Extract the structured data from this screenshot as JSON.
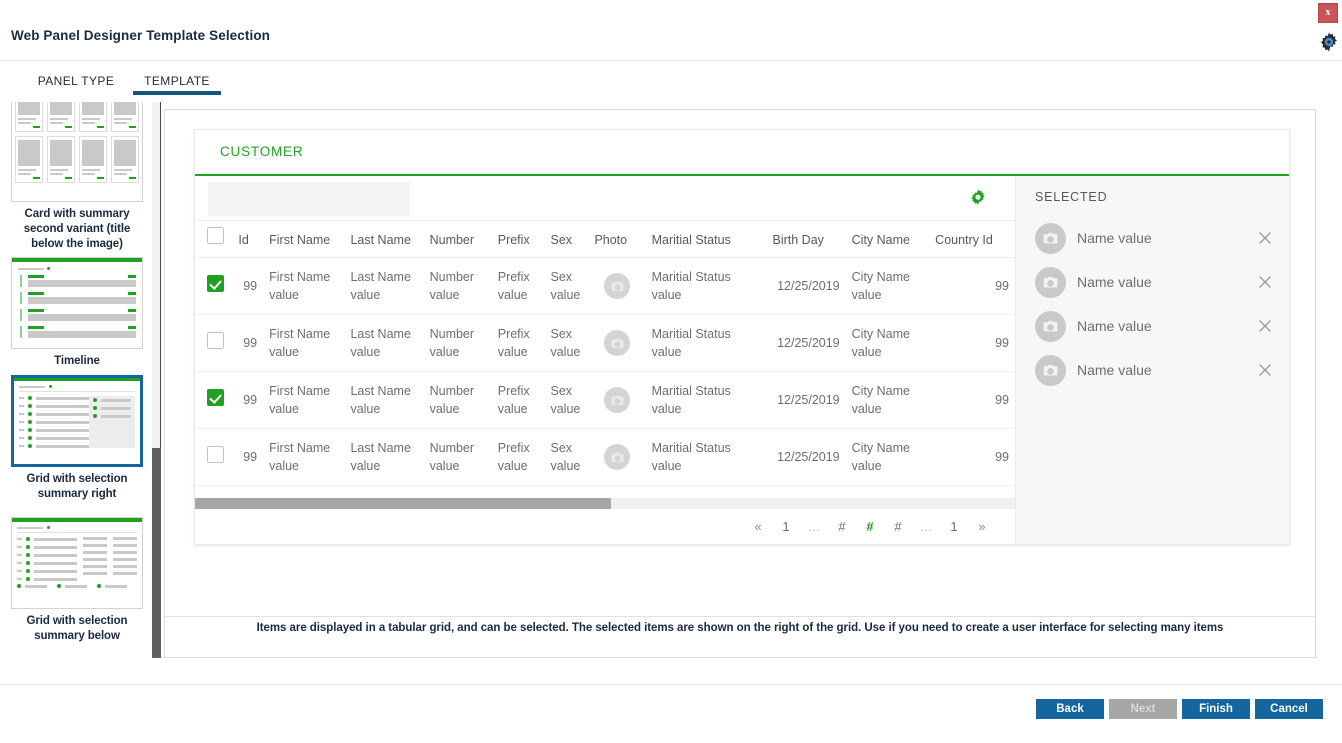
{
  "window": {
    "title": "Web Panel Designer Template Selection",
    "close_label": "x",
    "settings_icon": "gear-icon"
  },
  "tabs": [
    {
      "label": "PANEL TYPE",
      "active": false
    },
    {
      "label": "TEMPLATE",
      "active": true
    }
  ],
  "sidebar": {
    "items": [
      {
        "label": "Card with summary second variant (title below the image)",
        "selected": false
      },
      {
        "label": "Timeline",
        "selected": false
      },
      {
        "label": "Grid with selection summary right",
        "selected": true
      },
      {
        "label": "Grid with selection summary below",
        "selected": false
      }
    ]
  },
  "preview": {
    "card_title": "CUSTOMER",
    "filter_value": "",
    "settings_icon": "gear-icon",
    "grid": {
      "columns": [
        "",
        "Id",
        "First Name",
        "Last Name",
        "Number",
        "Prefix",
        "Sex",
        "Photo",
        "Maritial Status",
        "Birth Day",
        "City Name",
        "Country Id"
      ],
      "header_select_all_checked": false,
      "rows": [
        {
          "checked": true,
          "id": "99",
          "first_name": "First Name value",
          "last_name": "Last Name value",
          "number": "Number value",
          "prefix": "Prefix value",
          "sex": "Sex value",
          "photo": "camera-icon",
          "marital_status": "Maritial Status value",
          "birth_day": "12/25/2019",
          "city_name": "City Name value",
          "country_id": "99"
        },
        {
          "checked": false,
          "id": "99",
          "first_name": "First Name value",
          "last_name": "Last Name value",
          "number": "Number value",
          "prefix": "Prefix value",
          "sex": "Sex value",
          "photo": "camera-icon",
          "marital_status": "Maritial Status value",
          "birth_day": "12/25/2019",
          "city_name": "City Name value",
          "country_id": "99"
        },
        {
          "checked": true,
          "id": "99",
          "first_name": "First Name value",
          "last_name": "Last Name value",
          "number": "Number value",
          "prefix": "Prefix value",
          "sex": "Sex value",
          "photo": "camera-icon",
          "marital_status": "Maritial Status value",
          "birth_day": "12/25/2019",
          "city_name": "City Name value",
          "country_id": "99"
        },
        {
          "checked": false,
          "id": "99",
          "first_name": "First Name value",
          "last_name": "Last Name value",
          "number": "Number value",
          "prefix": "Prefix value",
          "sex": "Sex value",
          "photo": "camera-icon",
          "marital_status": "Maritial Status value",
          "birth_day": "12/25/2019",
          "city_name": "City Name value",
          "country_id": "99"
        }
      ]
    },
    "pagination": [
      {
        "label": "«",
        "kind": "arrow"
      },
      {
        "label": "1",
        "kind": "num"
      },
      {
        "label": "…",
        "kind": "dim"
      },
      {
        "label": "#",
        "kind": "num"
      },
      {
        "label": "#",
        "kind": "current"
      },
      {
        "label": "#",
        "kind": "num"
      },
      {
        "label": "…",
        "kind": "dim"
      },
      {
        "label": "1",
        "kind": "num"
      },
      {
        "label": "»",
        "kind": "arrow"
      }
    ],
    "selected_panel": {
      "title": "SELECTED",
      "items": [
        {
          "name": "Name value",
          "avatar": "camera-icon",
          "remove": "close-icon"
        },
        {
          "name": "Name value",
          "avatar": "camera-icon",
          "remove": "close-icon"
        },
        {
          "name": "Name value",
          "avatar": "camera-icon",
          "remove": "close-icon"
        },
        {
          "name": "Name value",
          "avatar": "camera-icon",
          "remove": "close-icon"
        }
      ]
    }
  },
  "caption": "Items are displayed in a tabular grid, and can be selected. The selected items are shown on the right of the grid. Use if you need to create a user interface for selecting many items",
  "footer": {
    "back": "Back",
    "next": "Next",
    "finish": "Finish",
    "cancel": "Cancel"
  },
  "colors": {
    "accent_green": "#21a121",
    "accent_blue": "#15659e",
    "tab_underline": "#14577e",
    "close_red": "#c9545a"
  }
}
